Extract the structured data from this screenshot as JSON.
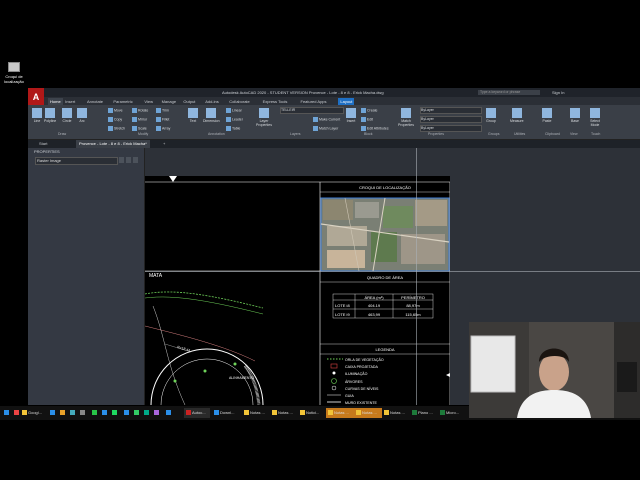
{
  "desktop": {
    "icon_label": "Croqui de localização"
  },
  "window": {
    "title": "Autodesk AutoCAD 2020 - STUDENT VERSION  Provence - Lote - 8 e 8 - Erick Macha.dwg",
    "search_placeholder": "Type a keyword or phrase",
    "signin": "Sign In"
  },
  "ribbon_tabs": [
    "Home",
    "Insert",
    "Annotate",
    "Parametric",
    "View",
    "Manage",
    "Output",
    "Add-ins",
    "Collaborate",
    "Express Tools",
    "Featured Apps",
    "Layout"
  ],
  "draw": {
    "line": "Line",
    "polyline": "Polyline",
    "circle": "Circle",
    "arc": "Arc"
  },
  "modify": {
    "move": "Move",
    "rotate": "Rotate",
    "trim": "Trim",
    "copy": "Copy",
    "mirror": "Mirror",
    "fillet": "Fillet",
    "stretch": "Stretch",
    "scale": "Scale",
    "array": "Array"
  },
  "annotation": {
    "text": "Text",
    "dimension": "Dimension",
    "linear": "Linear",
    "leader": "Leader",
    "table": "Table"
  },
  "layers": {
    "layer_props": "Layer Properties",
    "current": "TELLEIR",
    "make_current": "Make Current",
    "match_layer": "Match Layer"
  },
  "block": {
    "insert": "Insert",
    "create": "Create",
    "edit": "Edit",
    "edit_attributes": "Edit Attributes"
  },
  "properties": {
    "match": "Match Properties",
    "bylayer1": "ByLayer",
    "bylayer2": "ByLayer",
    "bylayer3": "ByLayer"
  },
  "utilities": {
    "group": "Group",
    "measure": "Measure",
    "paste": "Paste",
    "base": "Base",
    "select_mode": "Select Mode"
  },
  "panel_labels": {
    "draw": "Draw",
    "modify": "Modify",
    "annotation": "Annotation",
    "layers": "Layers",
    "block": "Block",
    "properties": "Properties",
    "groups": "Groups",
    "utilities": "Utilities",
    "clipboard": "Clipboard",
    "view": "View",
    "touch": "Touch"
  },
  "doc_tabs": [
    "Start",
    "Provence - Lote - 8 e 8 - Erick Macha*"
  ],
  "props_panel": {
    "title": "PROPERTIES",
    "selection": "Raster Image"
  },
  "drawing": {
    "croqui_title": "CROQUI DE LOCALIZAÇÃO",
    "mata": "MATA",
    "quadro_title": "QUADRO DE ÁREA",
    "quadro_headers": [
      "ÁREA (m²)",
      "PERÍMETRO"
    ],
    "quadro_rows": [
      [
        "LOTE i8",
        "404.19",
        "88,97m"
      ],
      [
        "LOTE i9",
        "463,99",
        "115,65m"
      ]
    ],
    "legenda_title": "LEGENDA",
    "legenda_items": [
      "ORLA DE VEGETAÇÃO",
      "CAIXA PROJETADA",
      "ILUMINAÇÃO",
      "ÁRVORES",
      "CURVAS DE NÍVEIS",
      "GUIA",
      "MURO EXISTENTE"
    ],
    "curve_label": "ALINHAMENTO",
    "dim_label": "R=18.44"
  },
  "taskbar": [
    "Googl...",
    "Autoc...",
    "Downl...",
    "Notas ...",
    "Notas ...",
    "Notici...",
    "Notas ...",
    "Notas ...",
    "Notas ...",
    "Plano ...",
    "Micro..."
  ],
  "colors": {
    "accent": "#1e6fc4",
    "ribbon": "#3a3f47",
    "autocad_red": "#b01818",
    "vegetation": "#6fd35a"
  }
}
